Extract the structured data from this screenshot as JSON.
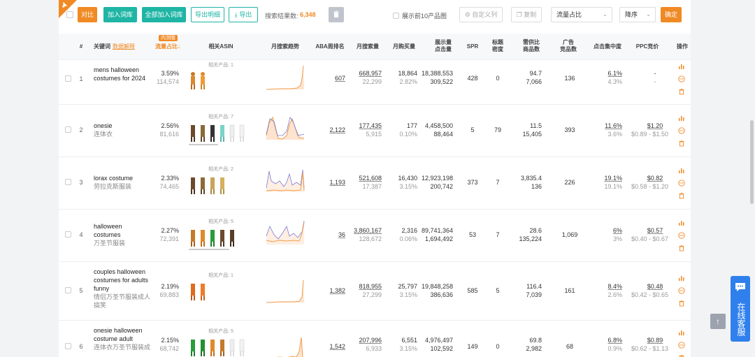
{
  "toolbar": {
    "compare_label": "对比",
    "add_to_library_label": "加入词库",
    "add_all_to_library_label": "全部加入词库",
    "export_detail_label": "导出明细",
    "export_label": "导出",
    "result_label": "搜索结果数:",
    "result_count": "6,348",
    "show_top10_label": "展示前10产品图",
    "custom_columns_label": "自定义列",
    "copy_label": "复制",
    "sort_field_value": "流量占比",
    "sort_order_value": "降序",
    "confirm_label": "确定"
  },
  "header": {
    "index": "#",
    "keyword": "关键词",
    "data_explain": "数据解释",
    "inner_badge": "内测版",
    "traffic_share": "流量占比",
    "related_asin": "相关ASIN",
    "monthly_trend": "月搜索趋势",
    "aba_rank": "ABA周排名",
    "monthly_search": "月搜索量",
    "monthly_purchase": "月购买量",
    "impressions_l1": "展示量",
    "impressions_l2": "点击量",
    "spr": "SPR",
    "title_density_l1": "标题",
    "title_density_l2": "密度",
    "supply_demand_l1": "需供比",
    "supply_demand_l2": "商品数",
    "ad_products_l1": "广告",
    "ad_products_l2": "竞品数",
    "click_concentration": "点击集中度",
    "ppc_bid": "PPC竞价",
    "actions": "操作"
  },
  "rows": [
    {
      "index": "1",
      "kw_en": "mens halloween costumes for 2024",
      "kw_cn": "",
      "share": "3.59%",
      "share_n": "114,574",
      "related": "相关产品: 1",
      "aba": "607",
      "msv": "668,957",
      "msv2": "22,299",
      "mpv": "18,864",
      "mpv2": "2.82%",
      "imp": "18,388,553",
      "clk": "309,522",
      "spr": "428",
      "tdens": "0",
      "dsr": "94.7",
      "dsr2": "7,066",
      "ads": "136",
      "conc": "6.1%",
      "conc2": "4.3%",
      "ppc": "-",
      "ppc2": "-"
    },
    {
      "index": "2",
      "kw_en": "onesie",
      "kw_cn": "连体衣",
      "share": "2.56%",
      "share_n": "81,616",
      "related": "相关产品: 7",
      "aba": "2,122",
      "msv": "177,435",
      "msv2": "5,915",
      "mpv": "177",
      "mpv2": "0.10%",
      "imp": "4,458,500",
      "clk": "88,464",
      "spr": "5",
      "tdens": "79",
      "dsr": "11.5",
      "dsr2": "15,405",
      "ads": "393",
      "conc": "11.6%",
      "conc2": "3.6%",
      "ppc": "$1.20",
      "ppc2": "$0.89 - $1.50"
    },
    {
      "index": "3",
      "kw_en": "lorax costume",
      "kw_cn": "劳拉克斯服装",
      "share": "2.33%",
      "share_n": "74,465",
      "related": "相关产品: 2",
      "aba": "1,193",
      "msv": "521,608",
      "msv2": "17,387",
      "mpv": "16,430",
      "mpv2": "3.15%",
      "imp": "12,923,198",
      "clk": "200,742",
      "spr": "373",
      "tdens": "7",
      "dsr": "3,835.4",
      "dsr2": "136",
      "ads": "226",
      "conc": "19.1%",
      "conc2": "19.1%",
      "ppc": "$0.82",
      "ppc2": "$0.58 - $1.20"
    },
    {
      "index": "4",
      "kw_en": "halloween costumes",
      "kw_cn": "万圣节服装",
      "share": "2.27%",
      "share_n": "72,391",
      "related": "相关产品: 5",
      "aba": "36",
      "msv": "3,860,167",
      "msv2": "128,672",
      "mpv": "2,316",
      "mpv2": "0.06%",
      "imp": "89,741,364",
      "clk": "1,694,492",
      "spr": "53",
      "tdens": "7",
      "dsr": "28.6",
      "dsr2": "135,224",
      "ads": "1,069",
      "conc": "6%",
      "conc2": "3%",
      "ppc": "$0.57",
      "ppc2": "$0.40 - $0.67"
    },
    {
      "index": "5",
      "kw_en": "couples halloween costumes for adults funny",
      "kw_cn": "情侣万圣节服装成人搞笑",
      "share": "2.19%",
      "share_n": "69,883",
      "related": "相关产品: 1",
      "aba": "1,382",
      "msv": "818,955",
      "msv2": "27,299",
      "mpv": "25,797",
      "mpv2": "3.15%",
      "imp": "19,848,258",
      "clk": "386,636",
      "spr": "585",
      "tdens": "5",
      "dsr": "116.4",
      "dsr2": "7,039",
      "ads": "161",
      "conc": "8.4%",
      "conc2": "2.6%",
      "ppc": "$0.48",
      "ppc2": "$0.42 - $0.65"
    },
    {
      "index": "6",
      "kw_en": "onesie halloween costume adult",
      "kw_cn": "连体衣万圣节服装成",
      "share": "2.15%",
      "share_n": "68,742",
      "related": "相关产品: 5",
      "aba": "1,542",
      "msv": "207,996",
      "msv2": "6,933",
      "mpv": "6,551",
      "mpv2": "3.15%",
      "imp": "4,976,497",
      "clk": "102,592",
      "spr": "149",
      "tdens": "0",
      "dsr": "69.8",
      "dsr2": "2,982",
      "ads": "68",
      "conc": "6.8%",
      "conc2": "0.9%",
      "ppc": "$0.89",
      "ppc2": "$0.62 - $1.13"
    }
  ],
  "side": {
    "service_label": "在线客服",
    "back_to_top_icon": "arrow-up-icon"
  },
  "colors": {
    "accent_orange": "#f08a24",
    "accent_green": "#1fb5a5",
    "trend_orange": "#f39c4a",
    "trend_blue": "#7b7bd6",
    "service_blue": "#2f80ed"
  }
}
